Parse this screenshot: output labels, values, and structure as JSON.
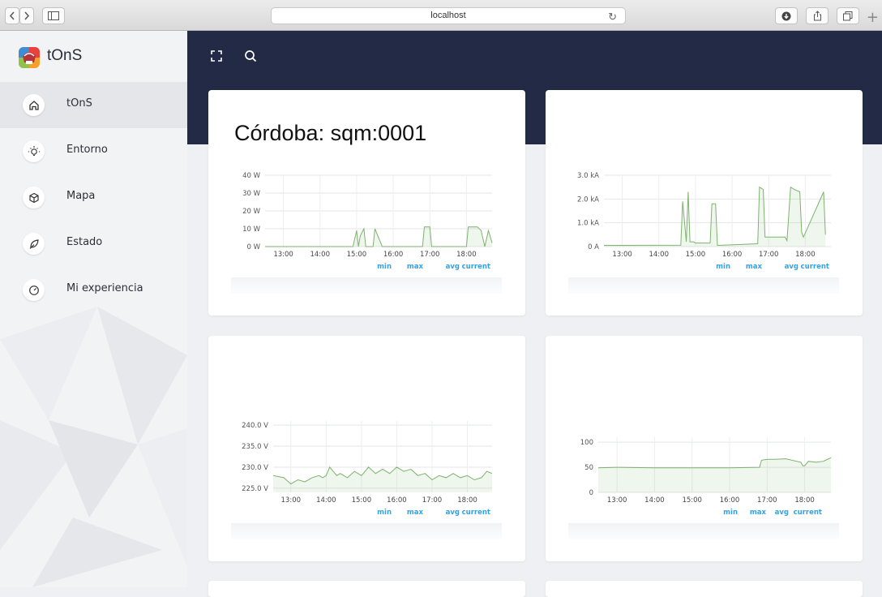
{
  "browser": {
    "url": "localhost"
  },
  "brand": {
    "name": "tOnS"
  },
  "sidebar": {
    "items": [
      {
        "label": "tOnS",
        "icon": "home-icon"
      },
      {
        "label": "Entorno",
        "icon": "lightbulb-icon"
      },
      {
        "label": "Mapa",
        "icon": "cube-icon"
      },
      {
        "label": "Estado",
        "icon": "leaf-icon"
      },
      {
        "label": "Mi experiencia",
        "icon": "gauge-icon"
      }
    ]
  },
  "topbar": {
    "icons": [
      "fullscreen-icon",
      "search-icon"
    ]
  },
  "cards": [
    {
      "title": "Córdoba: sqm:0001"
    },
    {
      "title": ""
    },
    {
      "title": ""
    },
    {
      "title": ""
    }
  ],
  "legend": {
    "min": "min",
    "max": "max",
    "avg": "avg",
    "current": "current"
  },
  "colors": {
    "series": "#7eb26d",
    "legend": "#33a2e5",
    "topbar": "#232a45"
  },
  "chart_data": [
    {
      "type": "area",
      "title": "",
      "x_ticks": [
        "13:00",
        "14:00",
        "15:00",
        "16:00",
        "17:00",
        "18:00"
      ],
      "y_ticks": [
        "0 W",
        "10 W",
        "20 W",
        "30 W",
        "40 W"
      ],
      "ylim": [
        0,
        40
      ],
      "xlim": [
        12.5,
        18.7
      ],
      "series": [
        {
          "x": [
            12.5,
            14.8,
            14.9,
            15.0,
            15.05,
            15.1,
            15.2,
            15.25,
            15.45,
            15.5,
            15.7,
            16.8,
            16.85,
            17.0,
            17.05,
            18.0,
            18.05,
            18.3,
            18.4,
            18.5,
            18.6,
            18.7
          ],
          "y": [
            0,
            0,
            0,
            9,
            0,
            6,
            10,
            0,
            0,
            10,
            0,
            0,
            11,
            11,
            0,
            0,
            11,
            11,
            9,
            0,
            9,
            2
          ]
        }
      ]
    },
    {
      "type": "area",
      "title": "",
      "x_ticks": [
        "13:00",
        "14:00",
        "15:00",
        "16:00",
        "17:00",
        "18:00"
      ],
      "y_ticks": [
        "0 A",
        "1.0 kA",
        "2.0 kA",
        "3.0 kA"
      ],
      "ylim": [
        0,
        3000
      ],
      "xlim": [
        12.5,
        18.7
      ],
      "series": [
        {
          "x": [
            12.5,
            14.6,
            14.65,
            14.75,
            14.8,
            14.85,
            14.95,
            15.0,
            15.4,
            15.45,
            15.55,
            15.6,
            16.7,
            16.75,
            16.85,
            16.9,
            17.45,
            17.5,
            17.6,
            17.7,
            17.85,
            17.9,
            17.95,
            18.5,
            18.55
          ],
          "y": [
            50,
            60,
            1900,
            200,
            2300,
            200,
            200,
            150,
            150,
            1800,
            1800,
            50,
            120,
            2500,
            2400,
            400,
            400,
            250,
            2500,
            2400,
            2300,
            600,
            400,
            2300,
            500
          ]
        }
      ]
    },
    {
      "type": "area",
      "title": "",
      "x_ticks": [
        "13:00",
        "14:00",
        "15:00",
        "16:00",
        "17:00",
        "18:00"
      ],
      "y_ticks": [
        "225.0 V",
        "230.0 V",
        "235.0 V",
        "240.0 V"
      ],
      "ylim": [
        224,
        241
      ],
      "xlim": [
        12.5,
        18.7
      ],
      "series": [
        {
          "x": [
            12.5,
            12.8,
            13.0,
            13.2,
            13.4,
            13.6,
            13.8,
            13.9,
            14.0,
            14.05,
            14.1,
            14.3,
            14.4,
            14.6,
            14.8,
            15.0,
            15.2,
            15.4,
            15.6,
            15.8,
            16.0,
            16.2,
            16.4,
            16.6,
            16.8,
            17.0,
            17.2,
            17.4,
            17.6,
            17.8,
            18.0,
            18.2,
            18.4,
            18.55,
            18.7
          ],
          "y": [
            228,
            227.5,
            226,
            227,
            226.5,
            227.5,
            228,
            227.5,
            228,
            229,
            230,
            228,
            228.5,
            227.5,
            229,
            228,
            230,
            228.5,
            229.5,
            228.5,
            230,
            229,
            229.5,
            228,
            228.5,
            227,
            228,
            227.5,
            228.5,
            227.5,
            228,
            227,
            227.5,
            229,
            228.5
          ]
        }
      ]
    },
    {
      "type": "area",
      "title": "",
      "x_ticks": [
        "13:00",
        "14:00",
        "15:00",
        "16:00",
        "17:00",
        "18:00"
      ],
      "y_ticks": [
        "0",
        "50",
        "100"
      ],
      "ylim": [
        0,
        110
      ],
      "xlim": [
        12.5,
        18.7
      ],
      "series": [
        {
          "x": [
            12.5,
            13.0,
            14.0,
            15.0,
            16.0,
            16.8,
            16.85,
            17.0,
            17.2,
            17.5,
            17.9,
            17.95,
            18.0,
            18.1,
            18.3,
            18.5,
            18.7
          ],
          "y": [
            49,
            50,
            49,
            49,
            49,
            50,
            64,
            66,
            66,
            67,
            60,
            53,
            53,
            62,
            60,
            62,
            69
          ]
        }
      ]
    }
  ]
}
